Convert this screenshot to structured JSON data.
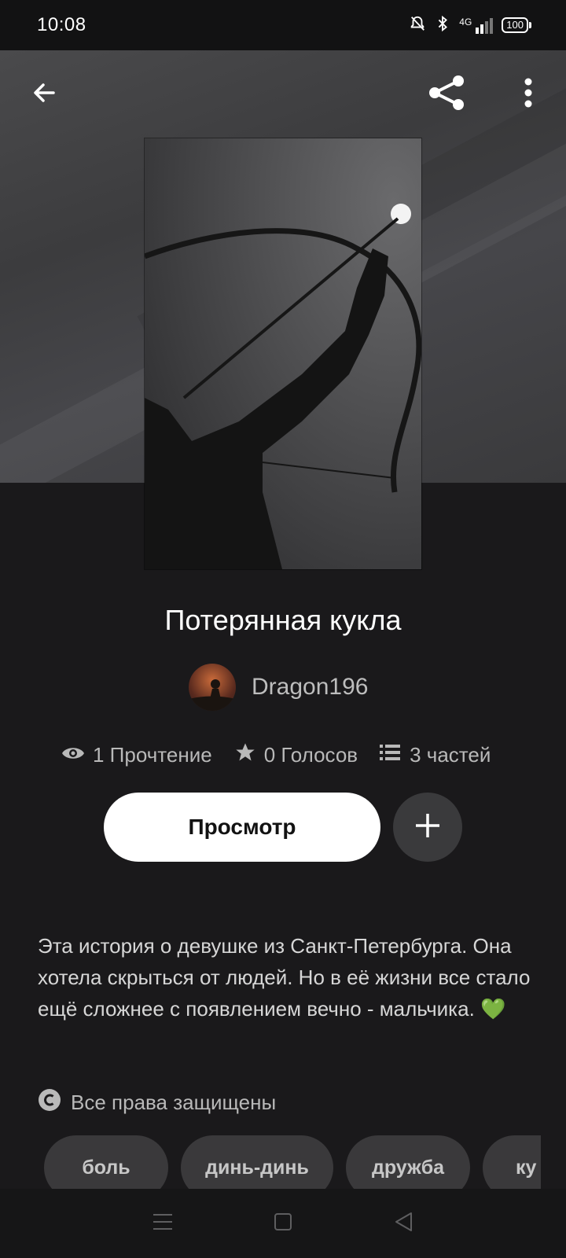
{
  "status_bar": {
    "time": "10:08",
    "network": "4G",
    "battery": "100"
  },
  "toolbar": {
    "back_icon": "arrow-left-icon",
    "share_icon": "share-icon",
    "more_icon": "more-vertical-icon"
  },
  "story": {
    "title": "Потерянная кукла",
    "author": "Dragon196",
    "stats": {
      "reads": "1 Прочтение",
      "votes": "0 Голосов",
      "parts": "3 частей"
    },
    "view_button": "Просмотр",
    "description": "Эта история о девушке из Санкт-Петербурга. Она хотела скрыться от людей. Но в её жизни все стало ещё сложнее с появлением вечно - мальчика. 💚",
    "rights": "Все права защищены",
    "tags": [
      "боль",
      "динь-динь",
      "дружба",
      "ку"
    ]
  },
  "colors": {
    "background": "#1a191b",
    "hero": "#444446",
    "button_primary": "#ffffff",
    "button_secondary": "#3a3a3c",
    "tag_bg": "#3a393b"
  }
}
